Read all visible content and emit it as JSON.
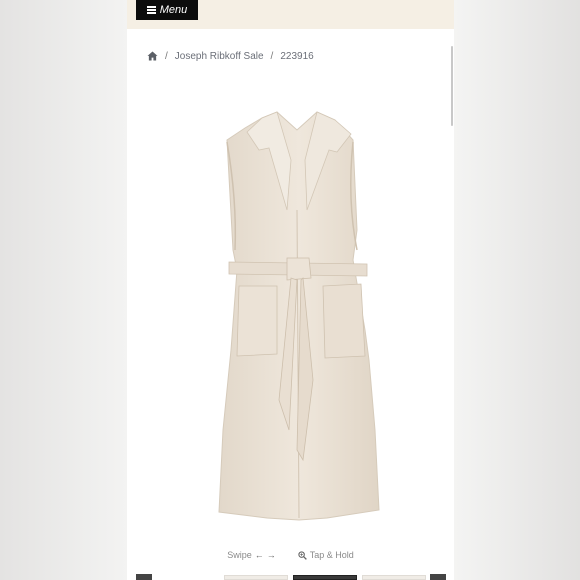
{
  "menu": {
    "label": "Menu",
    "icon": "hamburger-icon"
  },
  "breadcrumb": {
    "home_icon": "home-icon",
    "separator": "/",
    "items": [
      "Joseph Ribkoff Sale",
      "223916"
    ]
  },
  "product": {
    "image_icon": "sleeveless-belted-vest-image"
  },
  "hints": {
    "swipe": "Swipe",
    "swipe_left": "←",
    "swipe_right": "→",
    "zoom": "Tap & Hold",
    "zoom_icon": "zoom-in-icon"
  },
  "colors": {
    "topbar": "#f5efe4",
    "menu_bg": "#0c0c0c",
    "garment": "#ebe2d6",
    "text_muted": "#6b6f78"
  }
}
